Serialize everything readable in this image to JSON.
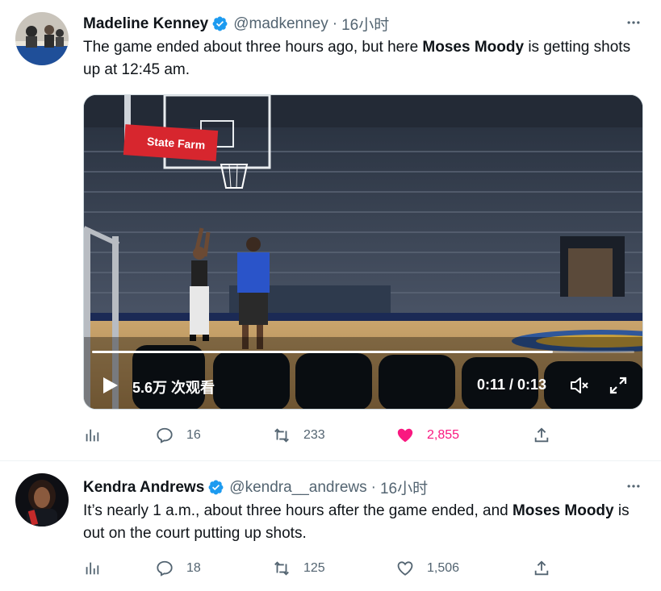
{
  "tweets": [
    {
      "author": {
        "display_name": "Madeline Kenney",
        "handle": "@madkenney",
        "verified_icon": "verified-badge-icon"
      },
      "time": "16小时",
      "text_parts": {
        "before": "The game ended about three hours ago, but here ",
        "bold": "Moses Moody",
        "after": " is getting shots up at 12:45 am."
      },
      "video": {
        "views": "5.6万 次观看",
        "duration": "0:11 / 0:13",
        "progress": 0.85,
        "sign_text": "State Farm"
      },
      "actions": {
        "replies": "16",
        "retweets": "233",
        "likes": "2,855",
        "liked": true
      }
    },
    {
      "author": {
        "display_name": "Kendra Andrews",
        "handle": "@kendra__andrews",
        "verified_icon": "verified-badge-icon"
      },
      "time": "16小时",
      "text_parts": {
        "before": "It’s nearly 1 a.m., about three hours after the game ended, and ",
        "bold": "Moses Moody",
        "after": " is out on the court putting up shots."
      },
      "actions": {
        "replies": "18",
        "retweets": "125",
        "likes": "1,506",
        "liked": false
      }
    }
  ],
  "colors": {
    "verified": "#1d9bf0",
    "like_active": "#f91880",
    "secondary_text": "#536471"
  },
  "separator": "·"
}
